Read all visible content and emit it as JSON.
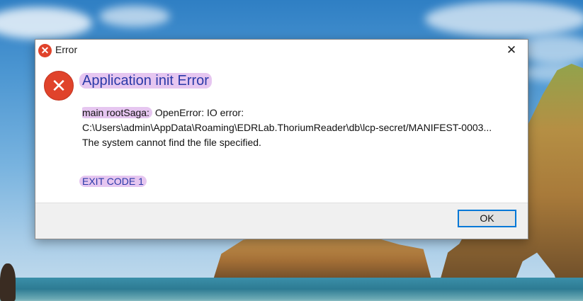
{
  "dialog": {
    "window_title": "Error",
    "title_icon": "error-icon",
    "close_glyph": "✕",
    "heading": "Application init Error",
    "message_prefix": "main rootSaga:",
    "message_rest": " OpenError: IO error:",
    "message_path": "C:\\Users\\admin\\AppData\\Roaming\\EDRLab.ThoriumReader\\db\\lcp-secret/MANIFEST-0003...",
    "message_detail": "The system cannot find the file specified.",
    "exit_code": "EXIT CODE 1",
    "ok_label": "OK",
    "icon_glyph": "✕"
  },
  "colors": {
    "accent": "#0078d7",
    "error": "#e0432b",
    "heading": "#2b3aa8",
    "highlight": "#e6c6f0"
  }
}
